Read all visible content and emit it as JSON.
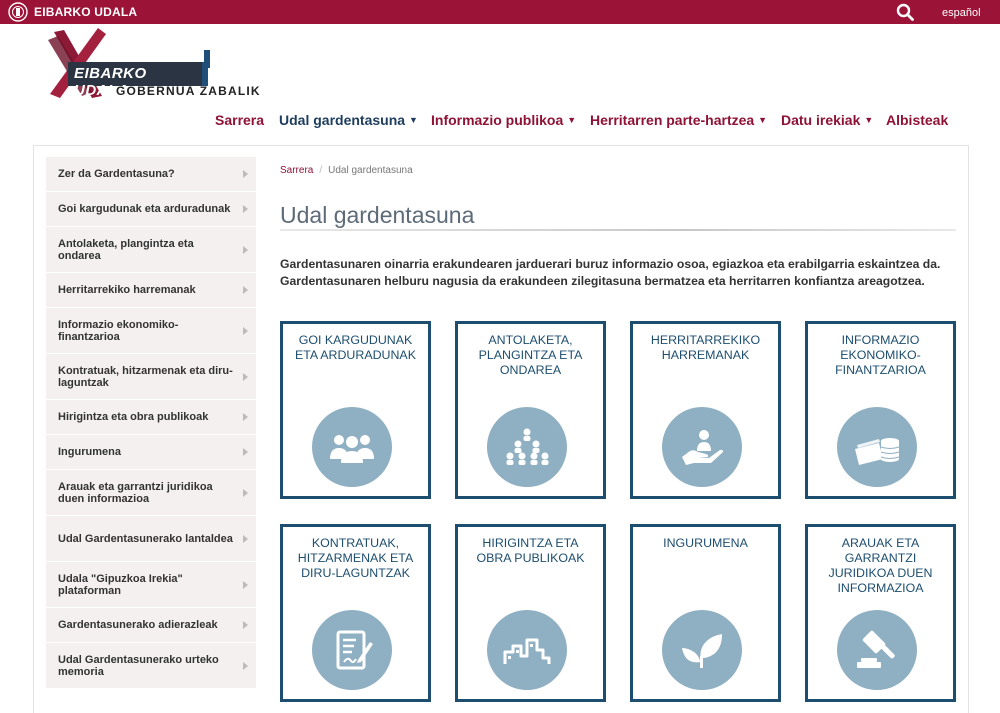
{
  "topbar": {
    "brand": "EIBARKO UDALA",
    "lang": "español",
    "search_icon": "search-icon"
  },
  "logo": {
    "main": "EIBARKO UDALA",
    "sub": "GOBERNUA ZABALIK"
  },
  "nav": [
    {
      "label": "Sarrera",
      "active": false,
      "caret": false
    },
    {
      "label": "Udal gardentasuna",
      "active": true,
      "caret": true
    },
    {
      "label": "Informazio publikoa",
      "active": false,
      "caret": true
    },
    {
      "label": "Herritarren parte-hartzea",
      "active": false,
      "caret": true
    },
    {
      "label": "Datu irekiak",
      "active": false,
      "caret": true
    },
    {
      "label": "Albisteak",
      "active": false,
      "caret": false
    }
  ],
  "sidebar": [
    "Zer da Gardentasuna?",
    "Goi kargudunak eta arduradunak",
    "Antolaketa, plangintza eta ondarea",
    "Herritarrekiko harremanak",
    "Informazio ekonomiko-finantzarioa",
    "Kontratuak, hitzarmenak eta diru-laguntzak",
    "Hirigintza eta obra publikoak",
    "Ingurumena",
    "Arauak eta garrantzi juridikoa duen informazioa",
    "Udal Gardentasunerako lantaldea",
    "Udala \"Gipuzkoa Irekia\" plataforman",
    "Gardentasunerako adierazleak",
    "Udal Gardentasunerako urteko memoria"
  ],
  "breadcrumb": {
    "home": "Sarrera",
    "current": "Udal gardentasuna"
  },
  "page_title": "Udal gardentasuna",
  "intro": "Gardentasunaren oinarria erakundearen jarduerari buruz informazio osoa, egiazkoa eta erabilgarria eskaintzea da. Gardentasunaren helburu nagusia da erakundeen zilegitasuna bermatzea eta herritarren konfiantza areagotzea.",
  "cards": [
    {
      "label": "GOI KARGUDUNAK ETA ARDURADUNAK",
      "icon": "people-icon"
    },
    {
      "label": "ANTOLAKETA, PLANGINTZA ETA ONDAREA",
      "icon": "organization-icon"
    },
    {
      "label": "HERRITARREKIKO HARREMANAK",
      "icon": "hand-person-icon"
    },
    {
      "label": "INFORMAZIO EKONOMIKO-FINANTZARIOA",
      "icon": "money-coins-icon"
    },
    {
      "label": "KONTRATUAK, HITZARMENAK ETA DIRU-LAGUNTZAK",
      "icon": "contract-icon"
    },
    {
      "label": "HIRIGINTZA ETA OBRA PUBLIKOAK",
      "icon": "buildings-icon"
    },
    {
      "label": "INGURUMENA",
      "icon": "leaf-icon"
    },
    {
      "label": "ARAUAK ETA GARRANTZI JURIDIKOA DUEN INFORMAZIOA",
      "icon": "gavel-icon"
    }
  ],
  "colors": {
    "brand": "#9b1438",
    "navy": "#1d4e6f",
    "circle": "#8fafc2"
  }
}
